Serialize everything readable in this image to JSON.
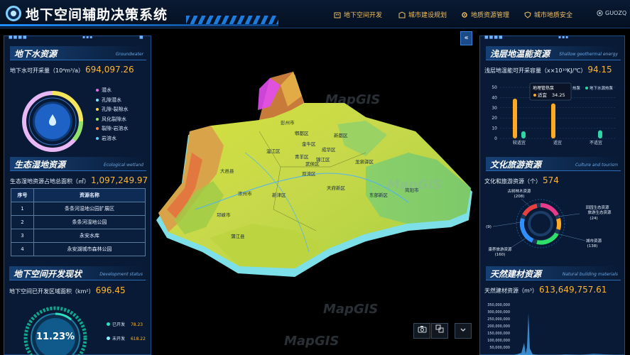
{
  "header": {
    "title": "地下空间辅助决策系统",
    "nav": [
      {
        "label": "地下空间开发",
        "icon": "building-icon"
      },
      {
        "label": "城市建设规划",
        "icon": "plan-icon"
      },
      {
        "label": "地质资源管理",
        "icon": "gear-icon"
      },
      {
        "label": "城市地质安全",
        "icon": "shield-icon"
      }
    ],
    "user": "GUOZQ"
  },
  "left": {
    "groundwater": {
      "title": "地下水资源",
      "subtitle": "Groundwater",
      "label": "地下水可开采量（10⁴m³/a）",
      "value": "694,097.26",
      "legend": [
        {
          "label": "潜水",
          "color": "#e66bf0"
        },
        {
          "label": "孔隙潜水",
          "color": "#7be3ff"
        },
        {
          "label": "孔隙-裂隙水",
          "color": "#f5d84a"
        },
        {
          "label": "风化裂隙水",
          "color": "#9ee86b"
        },
        {
          "label": "裂隙-岩溶水",
          "color": "#ff8a4c"
        },
        {
          "label": "岩溶水",
          "color": "#58d0ff"
        }
      ]
    },
    "wetland": {
      "title": "生态湿地资源",
      "subtitle": "Ecological wetland",
      "label": "生态湿地资源占地总面积（㎡）",
      "value": "1,097,249.97",
      "table": {
        "headers": [
          "序号",
          "资源名称"
        ],
        "rows": [
          [
            "1",
            "条条河湿地公园扩展区"
          ],
          [
            "2",
            "条条河湿地公园"
          ],
          [
            "3",
            "永安水库"
          ],
          [
            "4",
            "永安湖城市森林公园"
          ]
        ]
      }
    },
    "status": {
      "title": "地下空间开发现状",
      "subtitle": "Development status",
      "label": "地下空间已开发区域面积（km²）",
      "value": "696.45",
      "percent": "11.23%",
      "percent_fraction": 0.1123,
      "legend": [
        {
          "label": "已开发",
          "value": "78.23",
          "color": "#2ee0c0"
        },
        {
          "label": "未开发",
          "value": "618.22",
          "color": "#8af0ff"
        }
      ]
    }
  },
  "right": {
    "geothermal": {
      "title": "浅层地温能资源",
      "subtitle": "Shallow geothermal energy",
      "label": "浅层地温能可开采容量（x×10¹⁰KJ/℃）",
      "value": "94.15",
      "tooltip": {
        "title": "地埋管热泵",
        "item": "适宜",
        "value": "34.25"
      },
      "legend_tail": "热泵",
      "legend_second": "地下水源热泵",
      "chart_data": {
        "type": "bar",
        "categories": [
          "较适宜",
          "适宜",
          "不适宜"
        ],
        "series": [
          {
            "name": "地埋管热泵",
            "values": [
              39,
              34.25,
              0
            ]
          },
          {
            "name": "地下水源热泵",
            "values": [
              7,
              0,
              8
            ]
          }
        ],
        "ylim": [
          0,
          50
        ],
        "yticks": [
          "0",
          "10",
          "20",
          "30",
          "40",
          "50"
        ],
        "colors": [
          "#ffaa22",
          "#2fd6a5"
        ]
      }
    },
    "culture": {
      "title": "文化旅游资源",
      "subtitle": "Culture and tourism",
      "label": "文化和旅游资源（个）",
      "value": "574",
      "labels": [
        {
          "text": "古树林木资源"
        },
        {
          "text": "(208)"
        },
        {
          "text": "田园生态资源"
        },
        {
          "text": "旅游生态资源"
        },
        {
          "text": "(24)"
        },
        {
          "text": "城市资源"
        },
        {
          "text": "(138)"
        },
        {
          "text": "康养旅游资源"
        },
        {
          "text": "(160)"
        },
        {
          "text": "(9)"
        }
      ]
    },
    "building": {
      "title": "天然建材资源",
      "subtitle": "Natural building materials",
      "label": "天然建材资源（m³）",
      "value": "613,649,757.61",
      "yticks": [
        "350,000,000",
        "300,000,000",
        "250,000,000",
        "200,000,000",
        "150,000,000",
        "100,000,000",
        "50,000,000"
      ]
    }
  },
  "map": {
    "districts": [
      "郫都区",
      "温江区",
      "成华区",
      "金牛区",
      "青羊区",
      "新都区",
      "龙泉驿区",
      "武侯区",
      "锦江区",
      "双流区",
      "天府新区",
      "新津区",
      "简阳市",
      "东部新区",
      "彭州市",
      "大邑县",
      "崇州市",
      "蒲江县",
      "邛崃市"
    ],
    "watermark": "MapGIS"
  }
}
